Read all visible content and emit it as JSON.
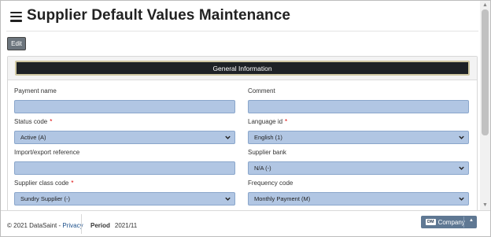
{
  "page": {
    "title": "Supplier Default Values Maintenance"
  },
  "toolbar": {
    "edit_label": "Edit"
  },
  "section": {
    "title": "General Information"
  },
  "fields": [
    {
      "label": "Payment name",
      "required": false,
      "type": "text",
      "value": ""
    },
    {
      "label": "Comment",
      "required": false,
      "type": "text",
      "value": ""
    },
    {
      "label": "Status code",
      "required": true,
      "type": "select",
      "value": "Active (A)"
    },
    {
      "label": "Language id",
      "required": true,
      "type": "select",
      "value": "English (1)"
    },
    {
      "label": "Import/export reference",
      "required": false,
      "type": "text",
      "value": ""
    },
    {
      "label": "Supplier bank",
      "required": false,
      "type": "select",
      "value": "N/A (-)"
    },
    {
      "label": "Supplier class code",
      "required": true,
      "type": "select",
      "value": "Sundry Supplier (-)"
    },
    {
      "label": "Frequency code",
      "required": false,
      "type": "select",
      "value": "Monthly Payment (M)"
    }
  ],
  "required_marker": "*",
  "footer": {
    "copyright": "© 2021 DataSaint - ",
    "privacy_label": "Privacy",
    "period_label": "Period",
    "period_value": "2021/11",
    "company_badge": "DM",
    "company_label": "Company"
  },
  "colors": {
    "field_bg": "#b1c6e3",
    "section_bar": "#1e2226",
    "company_button": "#5f7893",
    "edit_button": "#6c757d"
  },
  "icons": {
    "menu": "hamburger-icon",
    "select": "chevron-down-icon",
    "company_dropdown": "caret-up-icon"
  }
}
